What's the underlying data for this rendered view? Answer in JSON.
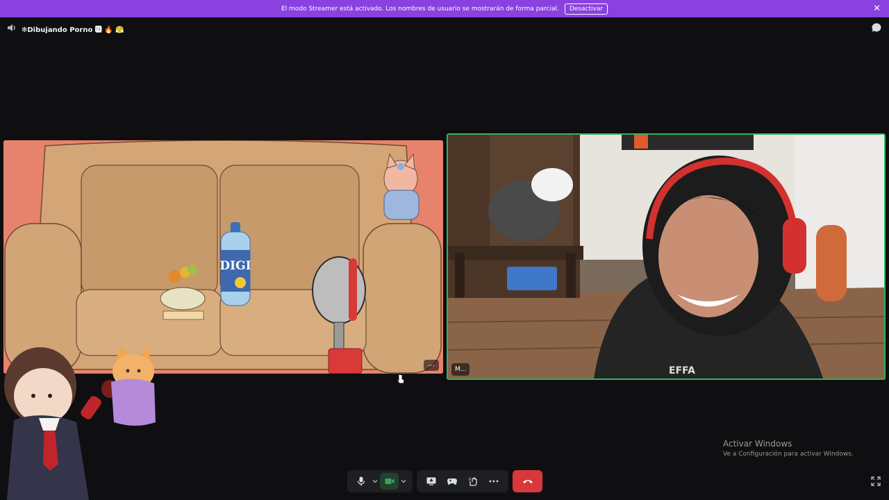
{
  "banner": {
    "message": "El modo Streamer está activado. Los nombres de usuario se mostrarán de forma parcial.",
    "button_label": "Desactivar"
  },
  "channel": {
    "name": "✻Dibujando Porno 🅼 🔥 😤",
    "icon": "voice-channel-icon"
  },
  "tiles": [
    {
      "name": "left-participant",
      "more_label": "...",
      "scene": {
        "bottle_label": "DIGI"
      }
    },
    {
      "name": "right-participant",
      "nametag": "M...",
      "speaking": true,
      "speaking_color": "#2fb55c",
      "scene": {
        "shirt_text": "EFFA"
      }
    }
  ],
  "watermark": {
    "line1": "Activar Windows",
    "line2": "Ve a Configuración para activar Windows."
  },
  "controls": {
    "mic": "microphone-icon",
    "mic_menu": "chevron-down-icon",
    "camera": "camera-icon",
    "camera_menu": "chevron-down-icon",
    "share": "screen-share-icon",
    "activities": "gamepad-icon",
    "soundboard": "soundboard-icon",
    "more": "more-icon",
    "hangup": "hang-up-icon"
  },
  "colors": {
    "accent_banner": "#8a41e0",
    "hangup": "#da373c",
    "speaking_border": "#2fb55c"
  }
}
